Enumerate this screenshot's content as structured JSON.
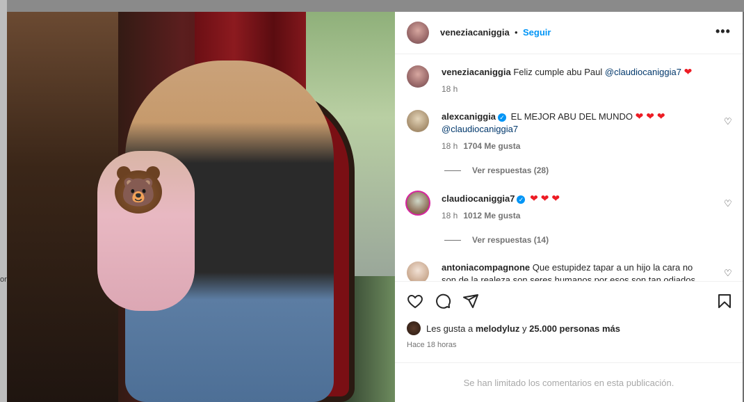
{
  "header": {
    "username": "veneziacaniggia",
    "separator": "•",
    "follow_label": "Seguir",
    "more_label": "•••"
  },
  "caption": {
    "username": "veneziacaniggia",
    "text": "Feliz cumple abu Paul",
    "mention": "@claudiocaniggia7",
    "emoji": "❤",
    "time": "18 h"
  },
  "comments": [
    {
      "username": "alexcaniggia",
      "verified": true,
      "text": "EL MEJOR ABU DEL MUNDO",
      "emoji": "❤ ❤ ❤",
      "mention": "@claudiocaniggia7",
      "time": "18 h",
      "likes": "1704 Me gusta",
      "replies": "Ver respuestas (28)"
    },
    {
      "username": "claudiocaniggia7",
      "verified": true,
      "emoji": "❤ ❤ ❤",
      "time": "18 h",
      "likes": "1012 Me gusta",
      "replies": "Ver respuestas (14)"
    },
    {
      "username": "antoniacompagnone",
      "text": "Que estupidez tapar a un hijo la cara no",
      "text2": "son de la realeza son seres humanos por esos son tan odiados"
    }
  ],
  "likes_row": {
    "prefix": "Les gusta a",
    "user": "melodyluz",
    "connector": "y",
    "count": "25.000 personas más"
  },
  "time_ago": "Hace 18 horas",
  "limited_notice": "Se han limitado los comentarios en esta publicación.",
  "backdrop_tick": "or",
  "icons": [
    "heart-icon",
    "comment-icon",
    "share-icon",
    "bookmark-icon",
    "more-icon",
    "verified-icon"
  ],
  "colors": {
    "link": "#0095f6",
    "mention": "#00376b",
    "heart": "#ed1c24",
    "muted": "#737373"
  }
}
